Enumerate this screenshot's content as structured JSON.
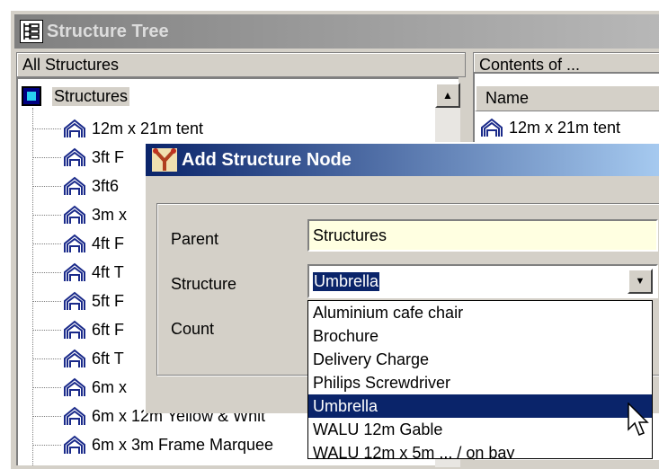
{
  "window": {
    "title": "Structure Tree"
  },
  "left_panel": {
    "header": "All Structures"
  },
  "tree": {
    "root_label": "Structures",
    "items": [
      "12m x 21m tent",
      "3ft F",
      "3ft6",
      "3m x",
      "4ft F",
      "4ft T",
      "5ft F",
      "6ft F",
      "6ft T",
      "6m x",
      "6m x 12m Yellow & Whit",
      "6m x 3m Frame Marquee"
    ]
  },
  "right_panel": {
    "header": "Contents of ...",
    "column_name": "Name",
    "items": [
      "12m x 21m tent"
    ]
  },
  "dialog": {
    "title": "Add Structure Node",
    "parent_label": "Parent",
    "parent_value": "Structures",
    "structure_label": "Structure",
    "structure_value": "Umbrella",
    "count_label": "Count"
  },
  "dropdown": {
    "options": [
      "Aluminium cafe chair",
      "Brochure",
      "Delivery Charge",
      "Philips Screwdriver",
      "Umbrella",
      "WALU 12m Gable",
      "WALU 12m x 5m ... / on bay"
    ],
    "highlighted": "Umbrella"
  },
  "colors": {
    "selection": "#0a246a",
    "input_yellow": "#ffffe1",
    "dialog_gradient_start": "#0a246a",
    "dialog_gradient_end": "#a6caf0"
  },
  "icons": {
    "title_icon": "structure-tree-icon",
    "root_icon": "structures-root-icon",
    "item_icon": "tent-icon",
    "dialog_icon": "node-fork-icon",
    "cursor": "mouse-pointer-icon"
  }
}
